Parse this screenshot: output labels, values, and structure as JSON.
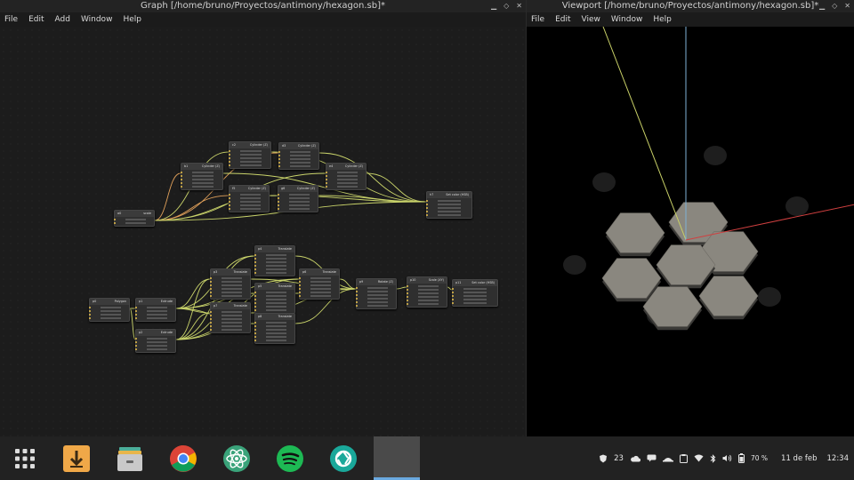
{
  "graph_window": {
    "title": "Graph [/home/bruno/Proyectos/antimony/hexagon.sb]*",
    "menu": [
      "File",
      "Edit",
      "Add",
      "Window",
      "Help"
    ],
    "controls": [
      "minimize-icon",
      "maximize-icon",
      "close-icon"
    ]
  },
  "viewport_window": {
    "title": "Viewport [/home/bruno/Proyectos/antimony/hexagon.sb]*",
    "menu": [
      "File",
      "Edit",
      "View",
      "Window",
      "Help"
    ],
    "controls": [
      "minimize-icon",
      "maximize-icon",
      "close-icon"
    ]
  },
  "nodes_top": [
    {
      "id": "a0",
      "title": "scale",
      "rows": 2
    },
    {
      "id": "b1",
      "title": "Cylinder (Z)",
      "rows": 5
    },
    {
      "id": "c2",
      "title": "Cylinder (Z)",
      "rows": 5
    },
    {
      "id": "d3",
      "title": "Cylinder (Z)",
      "rows": 5
    },
    {
      "id": "e4",
      "title": "Cylinder (Z)",
      "rows": 5
    },
    {
      "id": "f5",
      "title": "Cylinder (Z)",
      "rows": 5
    },
    {
      "id": "g6",
      "title": "Cylinder (Z)",
      "rows": 5
    },
    {
      "id": "h7",
      "title": "Set color (HSB)",
      "rows": 5
    }
  ],
  "nodes_bottom": [
    {
      "id": "p0",
      "title": "Polygon",
      "rows": 4
    },
    {
      "id": "p1",
      "title": "Extrude",
      "rows": 4
    },
    {
      "id": "p2",
      "title": "Extrude",
      "rows": 4
    },
    {
      "id": "p3",
      "title": "Translate",
      "rows": 6
    },
    {
      "id": "p4",
      "title": "Translate",
      "rows": 6
    },
    {
      "id": "p5",
      "title": "Translate",
      "rows": 6
    },
    {
      "id": "p6",
      "title": "Translate",
      "rows": 6
    },
    {
      "id": "p7",
      "title": "Translate",
      "rows": 6
    },
    {
      "id": "p8",
      "title": "Translate",
      "rows": 6
    },
    {
      "id": "p9",
      "title": "Rotate (Z)",
      "rows": 6
    },
    {
      "id": "p10",
      "title": "Scale (XY)",
      "rows": 6
    },
    {
      "id": "p11",
      "title": "Set color (HSB)",
      "rows": 5
    }
  ],
  "taskbar": {
    "apps": [
      "app-grid-icon",
      "downloader-icon",
      "files-icon",
      "chrome-icon",
      "atom-icon",
      "spotify-icon",
      "camera-icon"
    ],
    "tray": {
      "notification_count": "23",
      "battery": "70 %",
      "date": "11 de feb",
      "time": "12:34"
    }
  },
  "colors": {
    "accent": "#6aa9e0",
    "wire_yellow": "#c9d36a",
    "wire_orange": "#e0a05a",
    "hexagon": "#8a877f",
    "axis_red": "#d04040",
    "axis_blue": "#7fb2d6",
    "axis_yellow": "#c8d067"
  }
}
